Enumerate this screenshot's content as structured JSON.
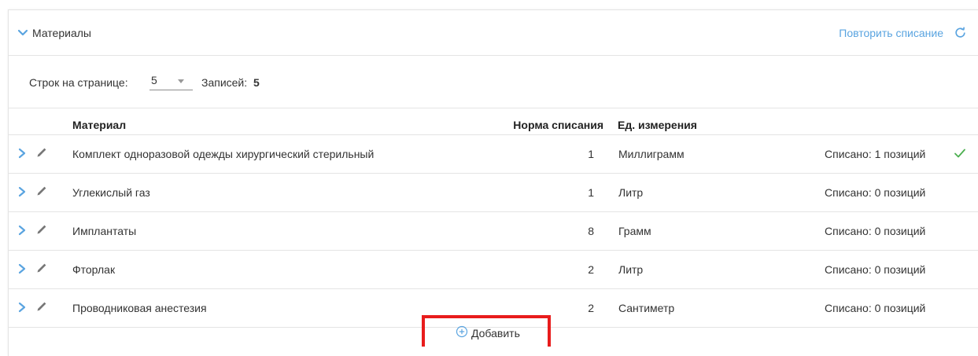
{
  "colors": {
    "accent": "#5aa4e0",
    "border": "#e4e4e4",
    "highlight": "#e81c1c",
    "check": "#4caf50"
  },
  "section": {
    "title": "Материалы",
    "repeat_link": "Повторить списание",
    "expand_icon": "chevron-down-icon",
    "refresh_icon": "refresh-icon"
  },
  "toolbar": {
    "rows_label": "Строк на странице:",
    "rows_value": "5",
    "records_label": "Записей:",
    "records_count": "5"
  },
  "table": {
    "headers": {
      "material": "Материал",
      "norm": "Норма списания",
      "unit": "Ед. измерения"
    },
    "rows": [
      {
        "name": "Комплект одноразовой одежды хирургический стерильный",
        "norm": "1",
        "unit": "Миллиграмм",
        "status": "Списано: 1 позиций",
        "checked": true
      },
      {
        "name": "Углекислый газ",
        "norm": "1",
        "unit": "Литр",
        "status": "Списано: 0 позиций",
        "checked": false
      },
      {
        "name": "Имплантаты",
        "norm": "8",
        "unit": "Грамм",
        "status": "Списано: 0 позиций",
        "checked": false
      },
      {
        "name": "Фторлак",
        "norm": "2",
        "unit": "Литр",
        "status": "Списано: 0 позиций",
        "checked": false
      },
      {
        "name": "Проводниковая анестезия",
        "norm": "2",
        "unit": "Сантиметр",
        "status": "Списано: 0 позиций",
        "checked": false
      }
    ]
  },
  "add_button": {
    "label": "Добавить",
    "icon": "plus-circle-icon"
  }
}
